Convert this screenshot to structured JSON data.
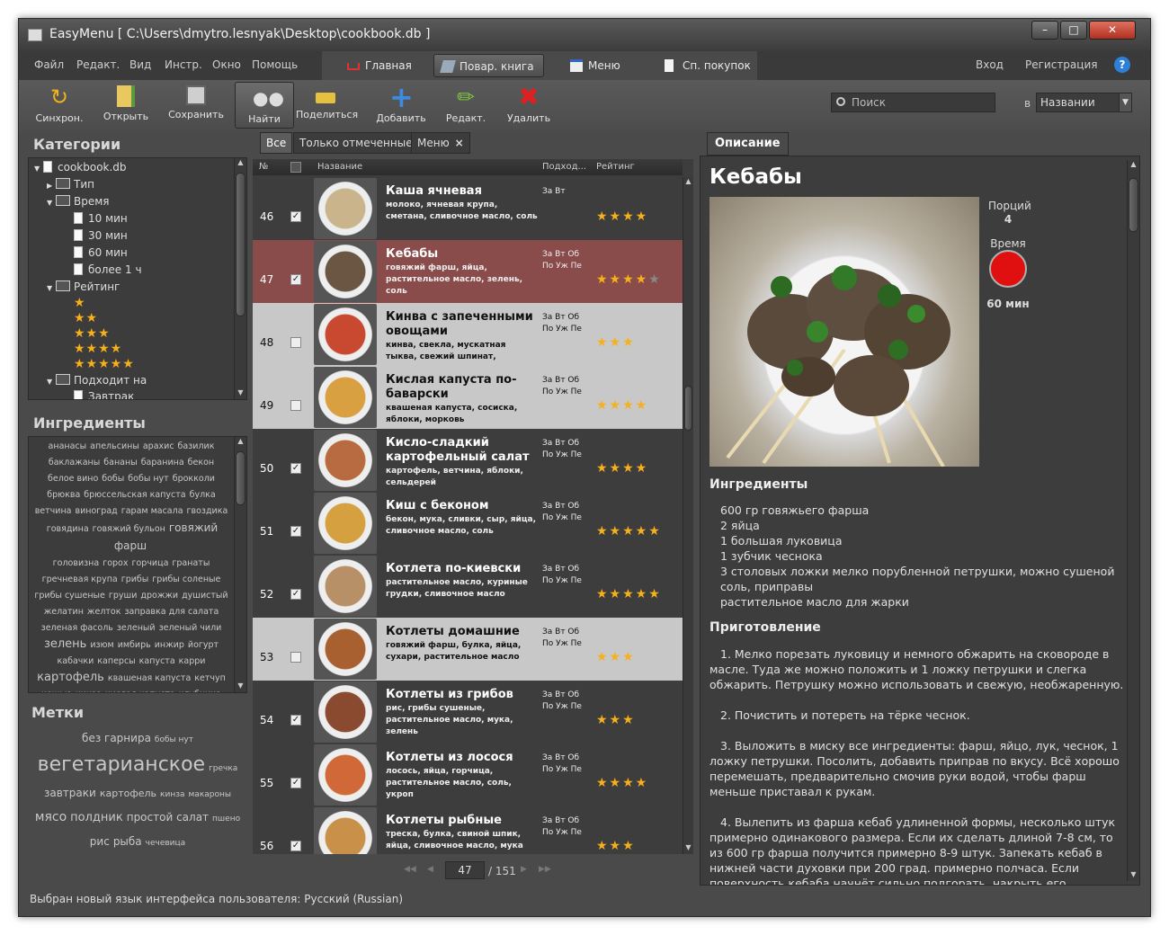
{
  "window": {
    "title": "EasyMenu [ C:\\Users\\dmytro.lesnyak\\Desktop\\cookbook.db ]"
  },
  "menu": [
    "Файл",
    "Редакт.",
    "Вид",
    "Инстр.",
    "Окно",
    "Помощь"
  ],
  "nav_tabs": [
    {
      "label": "Главная",
      "icon": "home-icon"
    },
    {
      "label": "Повар. книга",
      "icon": "cookbook-icon"
    },
    {
      "label": "Меню",
      "icon": "menu-icon"
    },
    {
      "label": "Сп. покупок",
      "icon": "shopping-list-icon"
    }
  ],
  "auth": {
    "login": "Вход",
    "register": "Регистрация",
    "help": "?"
  },
  "toolbar": [
    {
      "label": "Синхрон.",
      "icon": "sync-icon"
    },
    {
      "label": "Открыть",
      "icon": "open-icon"
    },
    {
      "label": "Сохранить",
      "icon": "save-icon"
    },
    {
      "label": "Найти",
      "icon": "binoculars-icon"
    },
    {
      "label": "Поделиться",
      "icon": "share-icon"
    },
    {
      "label": "Добавить",
      "icon": "add-icon"
    },
    {
      "label": "Редакт.",
      "icon": "edit-icon"
    },
    {
      "label": "Удалить",
      "icon": "delete-icon"
    }
  ],
  "search": {
    "placeholder": "Поиск",
    "in_label": "в",
    "field": "Названии"
  },
  "categories": {
    "title": "Категории",
    "root": "cookbook.db",
    "type": "Тип",
    "time": "Время",
    "time_items": [
      "10 мин",
      "30 мин",
      "60 мин",
      "более 1 ч"
    ],
    "rating": "Рейтинг",
    "rating_levels": [
      1,
      2,
      3,
      4,
      5
    ],
    "suits": "Подходит на",
    "suits_first": "Завтрак"
  },
  "ingredients_panel": {
    "title": "Ингредиенты",
    "lines": [
      [
        "ананасы",
        "апельсины",
        "арахис",
        "базилик"
      ],
      [
        "баклажаны",
        "бананы",
        "баранина",
        "бекон"
      ],
      [
        "белое вино",
        "бобы",
        "бобы нут",
        "брокколи"
      ],
      [
        "брюква",
        "брюссельская капуста",
        "булка"
      ],
      [
        "ветчина",
        "виноград",
        "гарам масала",
        "гвоздика"
      ],
      [
        "говядина",
        "говяжий бульон",
        "говяжий фарш"
      ],
      [
        "головизна",
        "горох",
        "горчица",
        "гранаты"
      ],
      [
        "гречневая крупа",
        "грибы",
        "грибы соленые"
      ],
      [
        "грибы сушеные",
        "груши",
        "дрожжи",
        "душистый"
      ],
      [
        "желатин",
        "желток",
        "заправка для салата"
      ],
      [
        "зеленая фасоль",
        "зеленый",
        "зеленый чили"
      ],
      [
        "зелень",
        "изюм",
        "имбирь",
        "инжир",
        "йогурт"
      ],
      [
        "кабачки",
        "каперсы",
        "капуста",
        "карри"
      ],
      [
        "картофель",
        "квашеная капуста",
        "кетчуп"
      ],
      [
        "кешью",
        "кинза",
        "кислая капуста",
        "клубника"
      ]
    ]
  },
  "tags_panel": {
    "title": "Метки",
    "lines": [
      [
        "без гарнира",
        "бобы нут"
      ],
      [
        "вегетарианское",
        "гречка"
      ],
      [
        "завтраки",
        "картофель",
        "кинза",
        "макароны"
      ],
      [
        "мясо",
        "полдник",
        "простой салат",
        "пшено"
      ],
      [
        "рис",
        "рыба",
        "чечевица"
      ]
    ]
  },
  "filter_tabs": [
    "Все",
    "Только отмеченные",
    "Меню"
  ],
  "filter_tab_close": "×",
  "grid": {
    "headers": {
      "num": "№",
      "name": "Название",
      "suits": "Подход...",
      "rating": "Рейтинг"
    },
    "rows": [
      {
        "num": "46",
        "checked": true,
        "name": "Каша ячневая",
        "ingredients": "молоко, ячневая крупа, сметана, сливочное масло, соль",
        "days": "За Вт",
        "rating": 4,
        "style": "dark"
      },
      {
        "num": "47",
        "checked": true,
        "name": "Кебабы",
        "ingredients": "говяжий фарш, яйца, растительное масло, зелень, соль",
        "days": "За Вт Об По Уж Пе",
        "rating": 4,
        "style": "sel"
      },
      {
        "num": "48",
        "checked": false,
        "name": "Кинва с запеченными овощами",
        "ingredients": "кинва, свекла, мускатная тыква, свежий шпинат, маслины",
        "days": "За Вт Об По Уж Пе",
        "rating": 3,
        "style": "light"
      },
      {
        "num": "49",
        "checked": false,
        "name": "Кислая капуста по-баварски",
        "ingredients": "квашеная капуста, сосиска, яблоки, морковь",
        "days": "За Вт Об По Уж Пе",
        "rating": 4,
        "style": "light"
      },
      {
        "num": "50",
        "checked": true,
        "name": "Кисло-сладкий картофельный салат",
        "ingredients": "картофель, ветчина, яблоки, сельдерей",
        "days": "За Вт Об По Уж Пе",
        "rating": 4,
        "style": "dark"
      },
      {
        "num": "51",
        "checked": true,
        "name": "Киш с беконом",
        "ingredients": "бекон, мука, сливки, сыр, яйца, сливочное масло, соль",
        "days": "За Вт Об По Уж Пе",
        "rating": 5,
        "style": "dark"
      },
      {
        "num": "52",
        "checked": true,
        "name": "Котлета по-киевски",
        "ingredients": "растительное масло, куриные грудки, сливочное масло",
        "days": "За Вт Об По Уж Пе",
        "rating": 5,
        "style": "dark"
      },
      {
        "num": "53",
        "checked": false,
        "name": "Котлеты домашние",
        "ingredients": "говяжий фарш, булка, яйца, сухари, растительное масло",
        "days": "За Вт Об По Уж Пе",
        "rating": 3,
        "style": "light"
      },
      {
        "num": "54",
        "checked": true,
        "name": "Котлеты из грибов",
        "ingredients": "рис, грибы сушеные, растительное масло, мука, зелень",
        "days": "За Вт Об По Уж Пе",
        "rating": 3,
        "style": "dark"
      },
      {
        "num": "55",
        "checked": true,
        "name": "Котлеты из лосося",
        "ingredients": "лосось, яйца, горчица, растительное масло, соль, укроп",
        "days": "За Вт Об По Уж Пе",
        "rating": 4,
        "style": "dark"
      },
      {
        "num": "56",
        "checked": true,
        "name": "Котлеты рыбные",
        "ingredients": "треска, булка, свиной шпик, яйца, сливочное масло, мука",
        "days": "За Вт Об По Уж Пе",
        "rating": 3,
        "style": "dark"
      }
    ]
  },
  "pager": {
    "current": "47",
    "total": "/ 151"
  },
  "detail": {
    "tab": "Описание",
    "title": "Кебабы",
    "servings_label": "Порций",
    "servings": "4",
    "time_label": "Время",
    "time": "60 мин",
    "ingredients_heading": "Ингредиенты",
    "ingredients": [
      "600 гр говяжьего фарша",
      "2 яйца",
      "1 большая луковица",
      "1 зубчик чеснока",
      "3 столовых ложки мелко порубленной петрушки, можно сушеной",
      "соль, приправы",
      "растительное масло для жарки"
    ],
    "prep_heading": "Приготовление",
    "steps": [
      "1. Мелко порезать луковицу и немного обжарить на сковороде в масле. Туда же можно положить и 1 ложку петрушки и слегка обжарить. Петрушку можно использовать и свежую, необжаренную.",
      "2. Почистить и потереть на тёрке чеснок.",
      "3. Выложить в миску все ингредиенты: фарш, яйцо, лук, чеснок, 1 ложку петрушки. Посолить, добавить приправ по вкусу. Всё хорошо перемешать, предварительно смочив руки водой, чтобы фарш меньше приставал к рукам.",
      "4. Вылепить из фарша кебаб удлиненной формы, несколько штук примерно одинакового размера. Если их сделать длиной 7-8 см, то из 600 гр фарша получится примерно 8-9 штук. Запекать кебаб в нижней части духовки при 200 град. примерно полчаса. Если поверхность кебаба начнёт сильно подгорать, накрыть его, например, фольгой."
    ]
  },
  "status": "Выбран новый язык интерфейса пользователя: Русский (Russian)",
  "colors": {
    "selected_row": "#8a4b4b",
    "star": "#f5b01c",
    "timer": "#e01010"
  }
}
